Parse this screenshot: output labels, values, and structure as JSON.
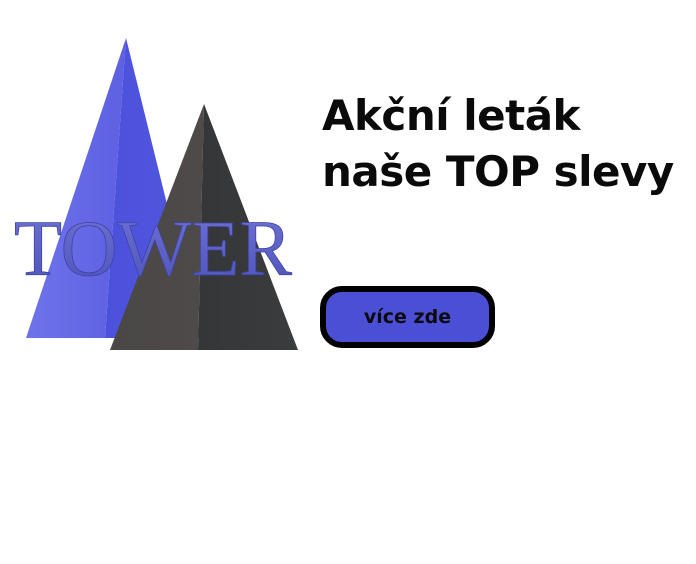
{
  "logo": {
    "text": "TOWER",
    "icon": "tower-pyramids-logo",
    "colors": {
      "blue_pyramid": "#5a5fe0",
      "dark_pyramid": "#3f3f44",
      "text": "#5b60c8"
    }
  },
  "headline": {
    "line1": "Akční leták",
    "line2": "naše TOP slevy"
  },
  "cta": {
    "label": "více zde",
    "color": "#4b4fd6",
    "border_color": "#000000"
  }
}
